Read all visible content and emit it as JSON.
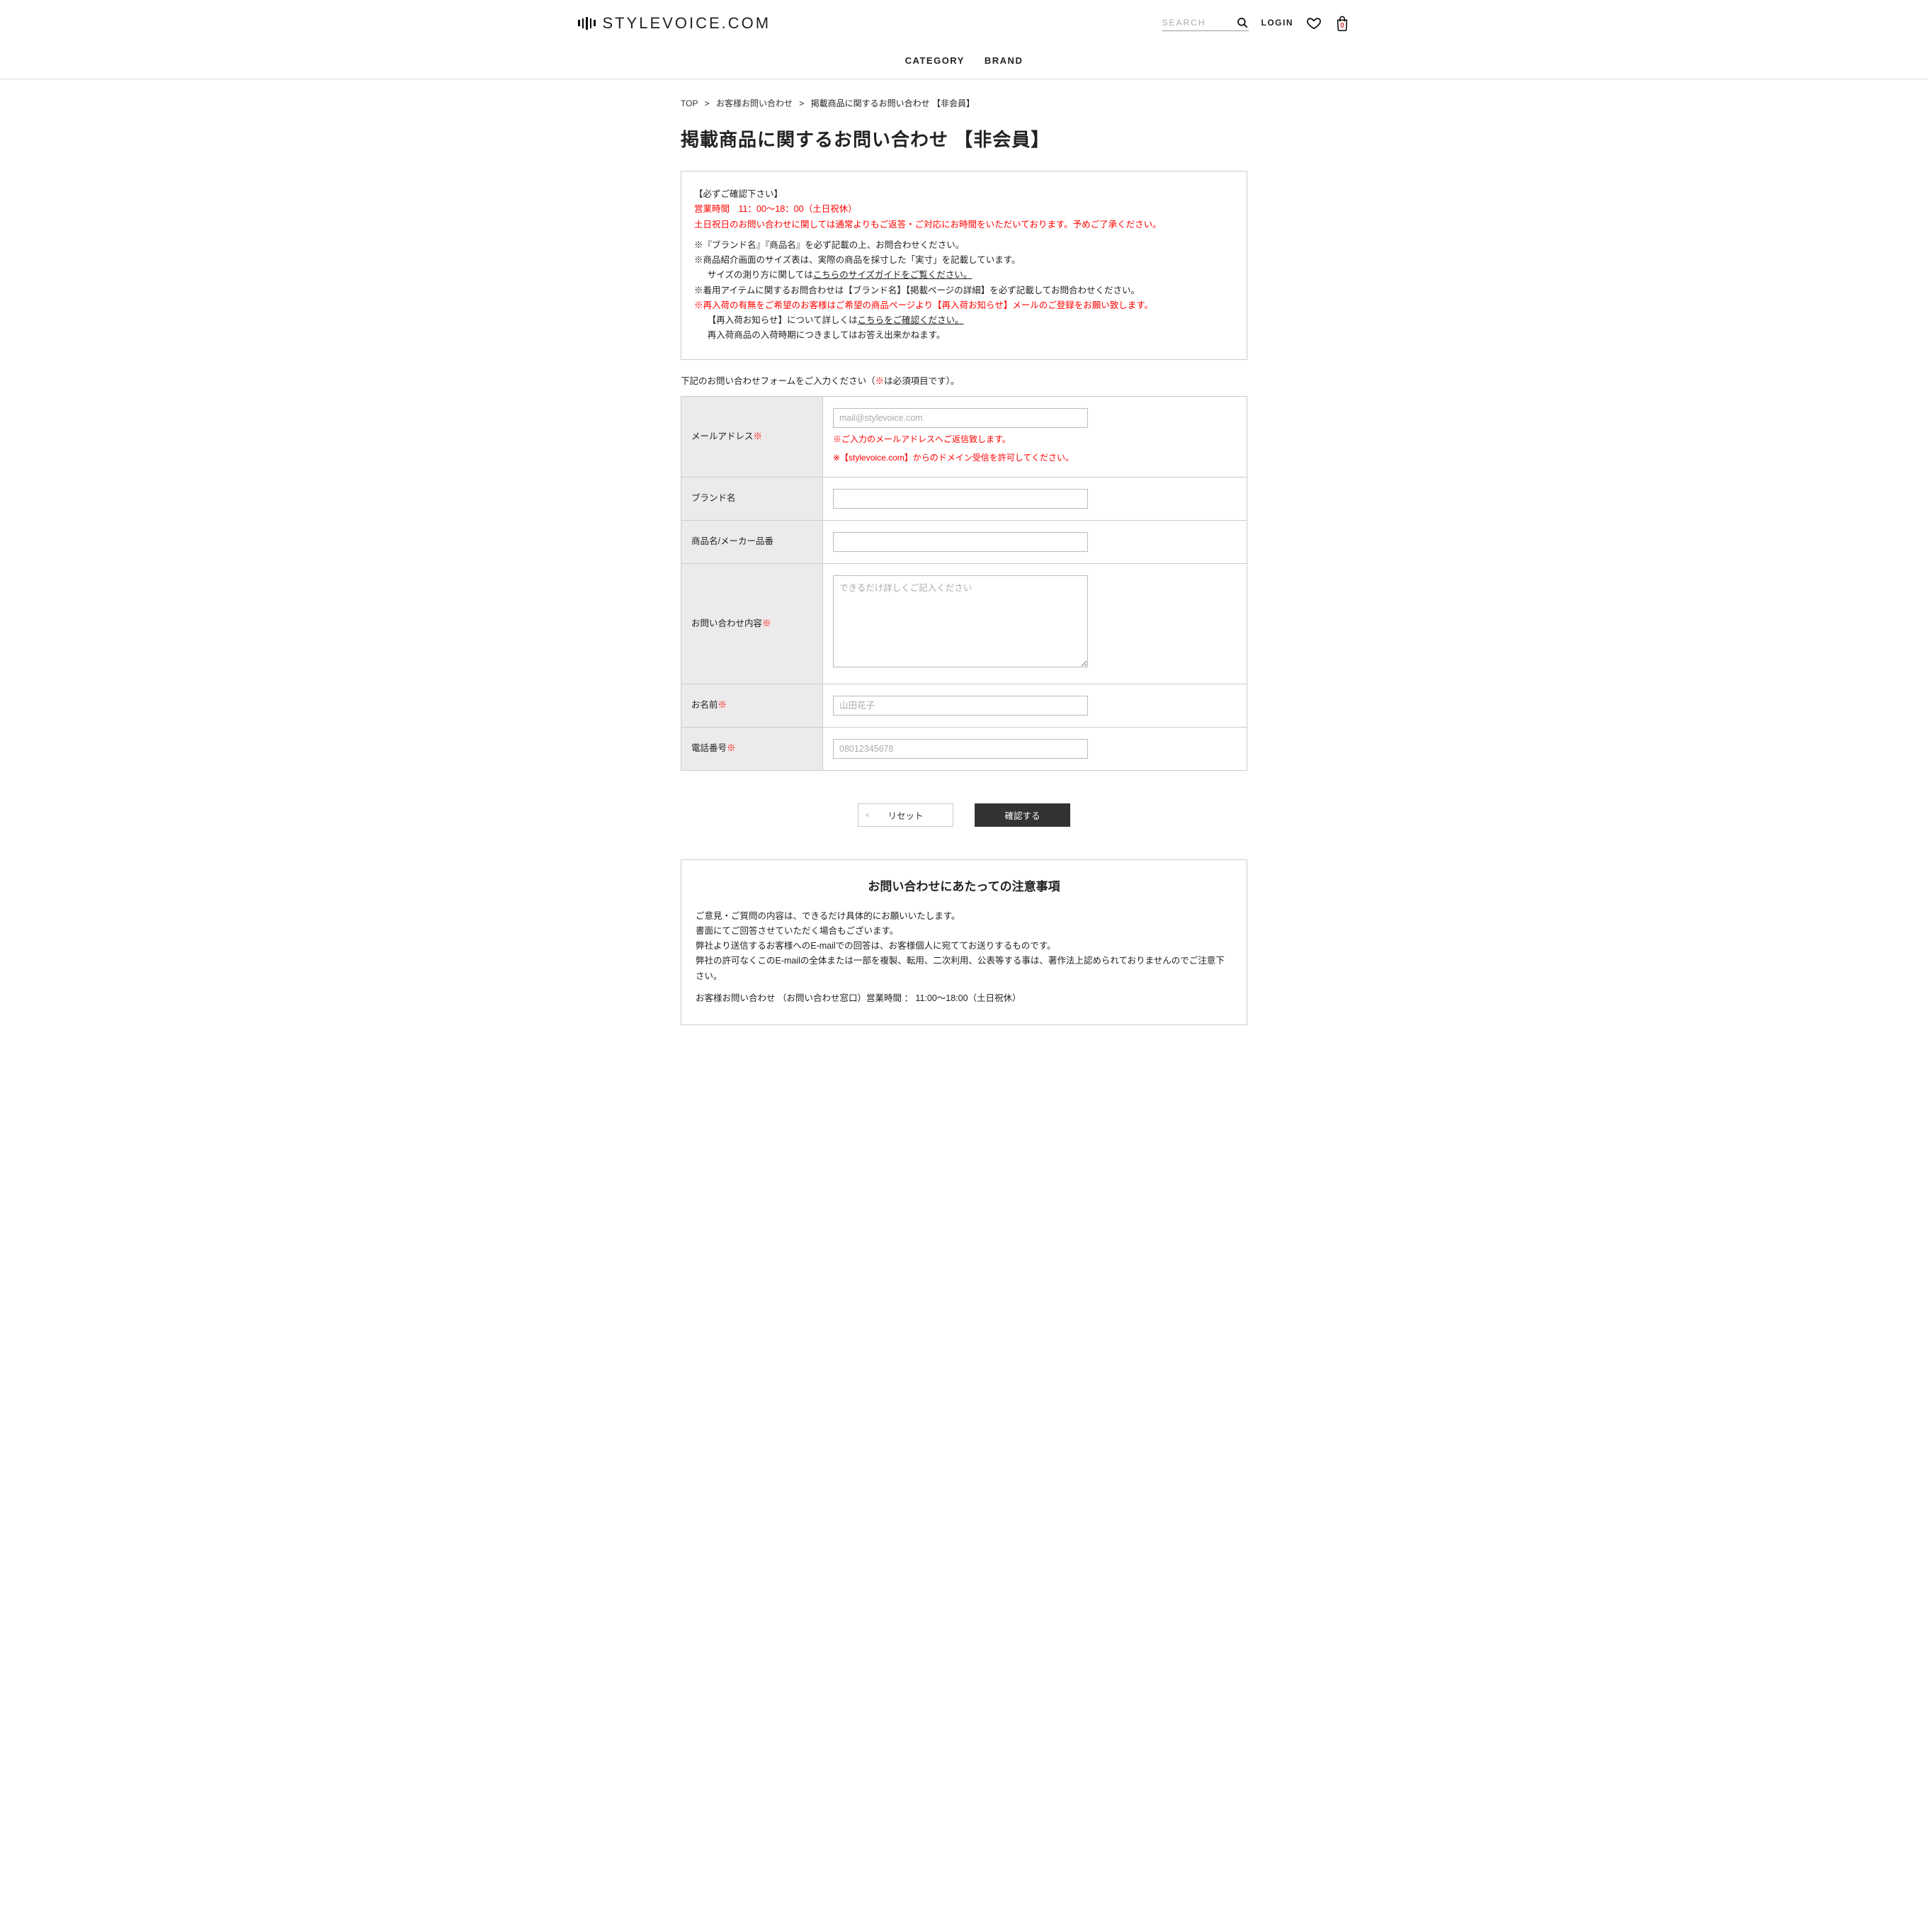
{
  "header": {
    "logo_text": "STYLEVOICE.COM",
    "search_placeholder": "SEARCH",
    "login": "LOGIN",
    "bag_count": "0"
  },
  "nav": {
    "category": "CATEGORY",
    "brand": "BRAND"
  },
  "crumbs": {
    "top": "TOP",
    "sep": ">",
    "c1": "お客様お問い合わせ",
    "c2": "掲載商品に関するお問い合わせ 【非会員】"
  },
  "title": "掲載商品に関するお問い合わせ 【非会員】",
  "notice": {
    "l1": "【必ずご確認下さい】",
    "l2": "営業時間　11：00～18：00（土日祝休）",
    "l3": "土日祝日のお問い合わせに関しては通常よりもご返答・ご対応にお時間をいただいております。予めご了承ください。",
    "l4a": "※『ブランド名』『商品名』を必ず記載の上、お問合わせください。",
    "l5a": "※商品紹介画面のサイズ表は、実際の商品を採寸した「実寸」を記載しています。",
    "l5b": "サイズの測り方に関しては",
    "l5c": "こちらのサイズガイドをご覧ください。",
    "l6": "※着用アイテムに関するお問合わせは【ブランド名】【掲載ページの詳細】を必ず記載してお問合わせください。",
    "l7": "※再入荷の有無をご希望のお客様はご希望の商品ページより【再入荷お知らせ】メールのご登録をお願い致します。",
    "l8a": "【再入荷お知らせ】について詳しくは",
    "l8b": "こちらをご確認ください。",
    "l9": "再入荷商品の入荷時期につきましてはお答え出来かねます。"
  },
  "form_lead_a": "下記のお問い合わせフォームをご入力ください（",
  "form_lead_b": "※",
  "form_lead_c": "は必須項目です）。",
  "form": {
    "email_label": "メールアドレス",
    "email_placeholder": "mail@stylevoice.com",
    "email_hint1": "※ご入力のメールアドレスへご返信致します。",
    "email_hint2": "※【stylevoice.com】からのドメイン受信を許可してください。",
    "brand_label": "ブランド名",
    "product_label": "商品名/メーカー品番",
    "content_label": "お問い合わせ内容",
    "content_placeholder": "できるだけ詳しくご記入ください",
    "name_label": "お名前",
    "name_placeholder": "山田花子",
    "phone_label": "電話番号",
    "phone_placeholder": "08012345678",
    "req": "※"
  },
  "buttons": {
    "reset": "リセット",
    "submit": "確認する"
  },
  "bottom": {
    "title": "お問い合わせにあたっての注意事項",
    "l1": "ご意見・ご質問の内容は、できるだけ具体的にお願いいたします。",
    "l2": "書面にてご回答させていただく場合もございます。",
    "l3": "弊社より送信するお客様へのE-mailでの回答は、お客様個人に宛ててお送りするものです。",
    "l4": "弊社の許可なくこのE-mailの全体または一部を複製、転用、二次利用、公表等する事は、著作法上認められておりませんのでご注意下さい。",
    "l5": "お客様お問い合わせ （お問い合わせ窓口）営業時間 ： 11:00～18:00（土日祝休）"
  }
}
